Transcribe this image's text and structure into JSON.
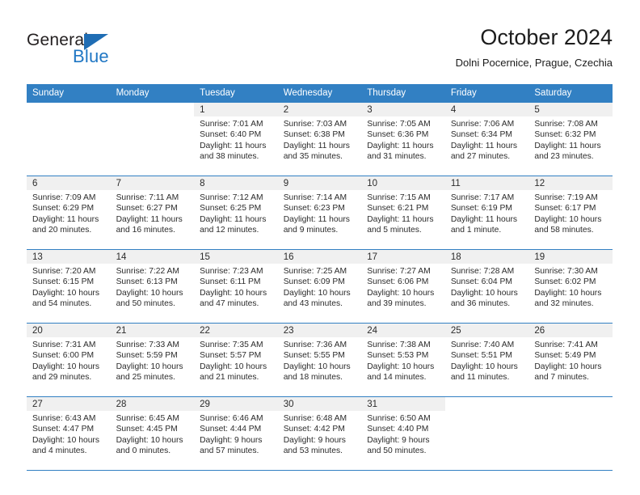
{
  "logo": {
    "primary_text": "General",
    "secondary_text": "Blue",
    "triangle_icon": "blue-triangle-icon",
    "primary_color": "#231f20",
    "secondary_color": "#2077c4"
  },
  "header": {
    "title": "October 2024",
    "subtitle": "Dolni Pocernice, Prague, Czechia"
  },
  "theme": {
    "header_row_bg": "#3280c3",
    "header_row_text": "#ffffff",
    "daynum_band_bg": "#f0f0f0",
    "row_divider": "#3280c3",
    "cell_bg": "#ffffff",
    "body_text": "#2b2b2b"
  },
  "weekday_headers": [
    "Sunday",
    "Monday",
    "Tuesday",
    "Wednesday",
    "Thursday",
    "Friday",
    "Saturday"
  ],
  "weeks": [
    [
      {
        "blank": true
      },
      {
        "blank": true
      },
      {
        "day": "1",
        "sunrise": "Sunrise: 7:01 AM",
        "sunset": "Sunset: 6:40 PM",
        "daylight": "Daylight: 11 hours and 38 minutes."
      },
      {
        "day": "2",
        "sunrise": "Sunrise: 7:03 AM",
        "sunset": "Sunset: 6:38 PM",
        "daylight": "Daylight: 11 hours and 35 minutes."
      },
      {
        "day": "3",
        "sunrise": "Sunrise: 7:05 AM",
        "sunset": "Sunset: 6:36 PM",
        "daylight": "Daylight: 11 hours and 31 minutes."
      },
      {
        "day": "4",
        "sunrise": "Sunrise: 7:06 AM",
        "sunset": "Sunset: 6:34 PM",
        "daylight": "Daylight: 11 hours and 27 minutes."
      },
      {
        "day": "5",
        "sunrise": "Sunrise: 7:08 AM",
        "sunset": "Sunset: 6:32 PM",
        "daylight": "Daylight: 11 hours and 23 minutes."
      }
    ],
    [
      {
        "day": "6",
        "sunrise": "Sunrise: 7:09 AM",
        "sunset": "Sunset: 6:29 PM",
        "daylight": "Daylight: 11 hours and 20 minutes."
      },
      {
        "day": "7",
        "sunrise": "Sunrise: 7:11 AM",
        "sunset": "Sunset: 6:27 PM",
        "daylight": "Daylight: 11 hours and 16 minutes."
      },
      {
        "day": "8",
        "sunrise": "Sunrise: 7:12 AM",
        "sunset": "Sunset: 6:25 PM",
        "daylight": "Daylight: 11 hours and 12 minutes."
      },
      {
        "day": "9",
        "sunrise": "Sunrise: 7:14 AM",
        "sunset": "Sunset: 6:23 PM",
        "daylight": "Daylight: 11 hours and 9 minutes."
      },
      {
        "day": "10",
        "sunrise": "Sunrise: 7:15 AM",
        "sunset": "Sunset: 6:21 PM",
        "daylight": "Daylight: 11 hours and 5 minutes."
      },
      {
        "day": "11",
        "sunrise": "Sunrise: 7:17 AM",
        "sunset": "Sunset: 6:19 PM",
        "daylight": "Daylight: 11 hours and 1 minute."
      },
      {
        "day": "12",
        "sunrise": "Sunrise: 7:19 AM",
        "sunset": "Sunset: 6:17 PM",
        "daylight": "Daylight: 10 hours and 58 minutes."
      }
    ],
    [
      {
        "day": "13",
        "sunrise": "Sunrise: 7:20 AM",
        "sunset": "Sunset: 6:15 PM",
        "daylight": "Daylight: 10 hours and 54 minutes."
      },
      {
        "day": "14",
        "sunrise": "Sunrise: 7:22 AM",
        "sunset": "Sunset: 6:13 PM",
        "daylight": "Daylight: 10 hours and 50 minutes."
      },
      {
        "day": "15",
        "sunrise": "Sunrise: 7:23 AM",
        "sunset": "Sunset: 6:11 PM",
        "daylight": "Daylight: 10 hours and 47 minutes."
      },
      {
        "day": "16",
        "sunrise": "Sunrise: 7:25 AM",
        "sunset": "Sunset: 6:09 PM",
        "daylight": "Daylight: 10 hours and 43 minutes."
      },
      {
        "day": "17",
        "sunrise": "Sunrise: 7:27 AM",
        "sunset": "Sunset: 6:06 PM",
        "daylight": "Daylight: 10 hours and 39 minutes."
      },
      {
        "day": "18",
        "sunrise": "Sunrise: 7:28 AM",
        "sunset": "Sunset: 6:04 PM",
        "daylight": "Daylight: 10 hours and 36 minutes."
      },
      {
        "day": "19",
        "sunrise": "Sunrise: 7:30 AM",
        "sunset": "Sunset: 6:02 PM",
        "daylight": "Daylight: 10 hours and 32 minutes."
      }
    ],
    [
      {
        "day": "20",
        "sunrise": "Sunrise: 7:31 AM",
        "sunset": "Sunset: 6:00 PM",
        "daylight": "Daylight: 10 hours and 29 minutes."
      },
      {
        "day": "21",
        "sunrise": "Sunrise: 7:33 AM",
        "sunset": "Sunset: 5:59 PM",
        "daylight": "Daylight: 10 hours and 25 minutes."
      },
      {
        "day": "22",
        "sunrise": "Sunrise: 7:35 AM",
        "sunset": "Sunset: 5:57 PM",
        "daylight": "Daylight: 10 hours and 21 minutes."
      },
      {
        "day": "23",
        "sunrise": "Sunrise: 7:36 AM",
        "sunset": "Sunset: 5:55 PM",
        "daylight": "Daylight: 10 hours and 18 minutes."
      },
      {
        "day": "24",
        "sunrise": "Sunrise: 7:38 AM",
        "sunset": "Sunset: 5:53 PM",
        "daylight": "Daylight: 10 hours and 14 minutes."
      },
      {
        "day": "25",
        "sunrise": "Sunrise: 7:40 AM",
        "sunset": "Sunset: 5:51 PM",
        "daylight": "Daylight: 10 hours and 11 minutes."
      },
      {
        "day": "26",
        "sunrise": "Sunrise: 7:41 AM",
        "sunset": "Sunset: 5:49 PM",
        "daylight": "Daylight: 10 hours and 7 minutes."
      }
    ],
    [
      {
        "day": "27",
        "sunrise": "Sunrise: 6:43 AM",
        "sunset": "Sunset: 4:47 PM",
        "daylight": "Daylight: 10 hours and 4 minutes."
      },
      {
        "day": "28",
        "sunrise": "Sunrise: 6:45 AM",
        "sunset": "Sunset: 4:45 PM",
        "daylight": "Daylight: 10 hours and 0 minutes."
      },
      {
        "day": "29",
        "sunrise": "Sunrise: 6:46 AM",
        "sunset": "Sunset: 4:44 PM",
        "daylight": "Daylight: 9 hours and 57 minutes."
      },
      {
        "day": "30",
        "sunrise": "Sunrise: 6:48 AM",
        "sunset": "Sunset: 4:42 PM",
        "daylight": "Daylight: 9 hours and 53 minutes."
      },
      {
        "day": "31",
        "sunrise": "Sunrise: 6:50 AM",
        "sunset": "Sunset: 4:40 PM",
        "daylight": "Daylight: 9 hours and 50 minutes."
      },
      {
        "blank": true
      },
      {
        "blank": true
      }
    ]
  ]
}
